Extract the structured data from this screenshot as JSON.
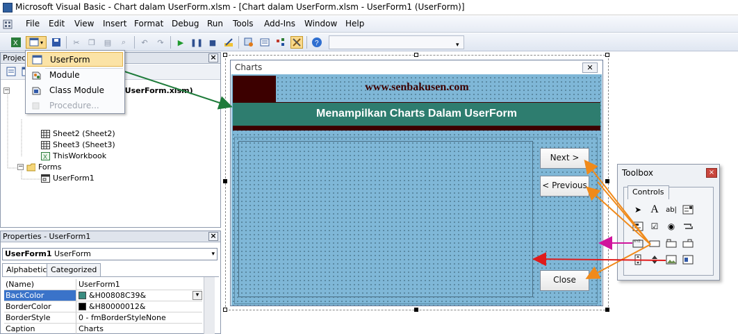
{
  "window": {
    "title": "Microsoft Visual Basic - Chart dalam UserForm.xlsm - [Chart dalam UserForm.xlsm - UserForm1 (UserForm)]"
  },
  "menubar": {
    "items": [
      "File",
      "Edit",
      "View",
      "Insert",
      "Format",
      "Debug",
      "Run",
      "Tools",
      "Add-Ins",
      "Window",
      "Help"
    ]
  },
  "insert_menu": {
    "items": [
      {
        "label": "UserForm",
        "state": "highlighted"
      },
      {
        "label": "Module",
        "state": "enabled"
      },
      {
        "label": "Class Module",
        "state": "enabled"
      },
      {
        "label": "Procedure...",
        "state": "disabled"
      }
    ]
  },
  "project_panel": {
    "title": "Project",
    "project_name_fragment": "n UserForm.xlsm)",
    "tree": [
      {
        "label": "Sheet2 (Sheet2)",
        "icon": "worksheet-icon"
      },
      {
        "label": "Sheet3 (Sheet3)",
        "icon": "worksheet-icon"
      },
      {
        "label": "ThisWorkbook",
        "icon": "workbook-icon"
      },
      {
        "label": "Forms",
        "icon": "folder-icon"
      },
      {
        "label": "UserForm1",
        "icon": "userform-icon"
      }
    ]
  },
  "properties_panel": {
    "title": "Properties - UserForm1",
    "object_name": "UserForm1",
    "object_type": "UserForm",
    "tabs": [
      "Alphabetic",
      "Categorized"
    ],
    "rows": [
      {
        "name": "(Name)",
        "value": "UserForm1",
        "swatch": null
      },
      {
        "name": "BackColor",
        "value": "&H00808C39&",
        "swatch": "#3a8c80"
      },
      {
        "name": "BorderColor",
        "value": "&H80000012&",
        "swatch": "#000000"
      },
      {
        "name": "BorderStyle",
        "value": "0 - fmBorderStyleNone",
        "swatch": null
      },
      {
        "name": "Caption",
        "value": "Charts",
        "swatch": null
      }
    ]
  },
  "userform": {
    "caption": "Charts",
    "close_glyph": "✕",
    "website": "www.senbakusen.com",
    "heading": "Menampilkan Charts Dalam UserForm",
    "buttons": {
      "next": "Next >",
      "previous": "< Previous",
      "close": "Close"
    },
    "colors": {
      "background": "#7fb7d7",
      "banner_dark": "#3c0000",
      "band_teal": "#2e7d6f"
    }
  },
  "toolbox": {
    "title": "Toolbox",
    "tab": "Controls",
    "controls": [
      "select-objects-icon",
      "label-icon",
      "textbox-icon",
      "combobox-icon",
      "listbox-icon",
      "checkbox-icon",
      "optionbutton-icon",
      "togglebutton-icon",
      "frame-icon",
      "commandbutton-icon",
      "tabstrip-icon",
      "multipage-icon",
      "scrollbar-icon",
      "spinbutton-icon",
      "image-icon",
      "refedit-icon"
    ]
  },
  "annotation_colors": {
    "green_arrow": "#1e7b3a",
    "orange_arrow": "#f08a1a",
    "red_arrow": "#e01b1b",
    "magenta_arrow": "#d0149c"
  }
}
